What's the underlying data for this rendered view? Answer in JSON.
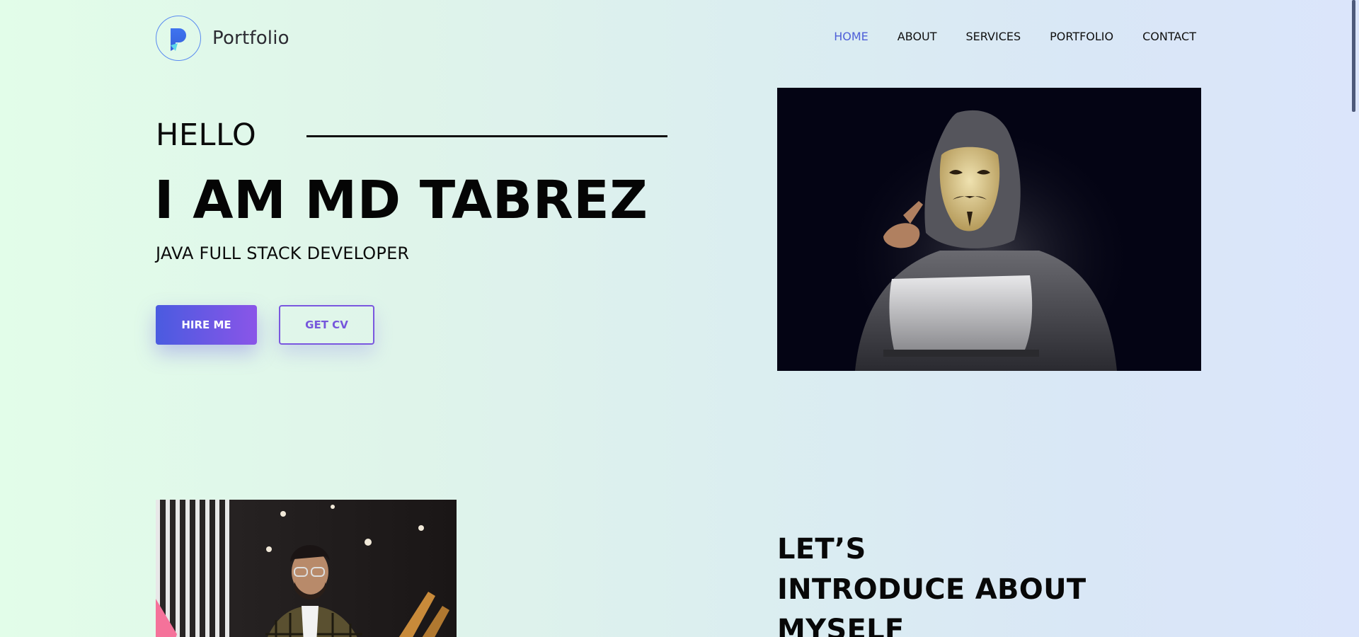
{
  "logo": {
    "text": "Portfolio",
    "icon": "p-logo-icon"
  },
  "nav": {
    "items": [
      {
        "label": "HOME",
        "active": true
      },
      {
        "label": "ABOUT",
        "active": false
      },
      {
        "label": "SERVICES",
        "active": false
      },
      {
        "label": "PORTFOLIO",
        "active": false
      },
      {
        "label": "CONTACT",
        "active": false
      }
    ]
  },
  "hero": {
    "greeting": "HELLO",
    "title": "I AM MD TABREZ",
    "subtitle": "JAVA FULL STACK DEVELOPER",
    "hire_label": "HIRE ME",
    "cv_label": "GET CV"
  },
  "about": {
    "heading_lines": [
      "LET’S",
      "INTRODUCE ABOUT",
      "MYSELF"
    ]
  },
  "colors": {
    "accent": "#4f60d8",
    "button_gradient_start": "#4a5be0",
    "button_gradient_end": "#8a55e8",
    "outline_button": "#7a57df"
  }
}
